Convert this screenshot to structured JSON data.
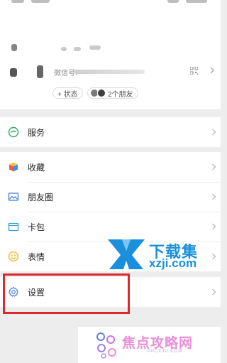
{
  "profile": {
    "wechat_id_prefix": "微信号：",
    "status_chip": "+ 状态",
    "friends_chip": "2个朋友"
  },
  "menu": {
    "services": "服务",
    "favorites": "收藏",
    "moments": "朋友圈",
    "wallet": "卡包",
    "stickers": "表情",
    "settings": "设置"
  },
  "watermarks": {
    "site1_title": "下载集",
    "site1_url": "xzji.com",
    "site2_title": "焦点攻略网",
    "site2_url": "PPCXJD.COM"
  },
  "colors": {
    "services_icon": "#2aae67",
    "highlight_box": "#e0282a",
    "watermark1": "#1a8fde",
    "watermark2": "#e88fd8"
  }
}
